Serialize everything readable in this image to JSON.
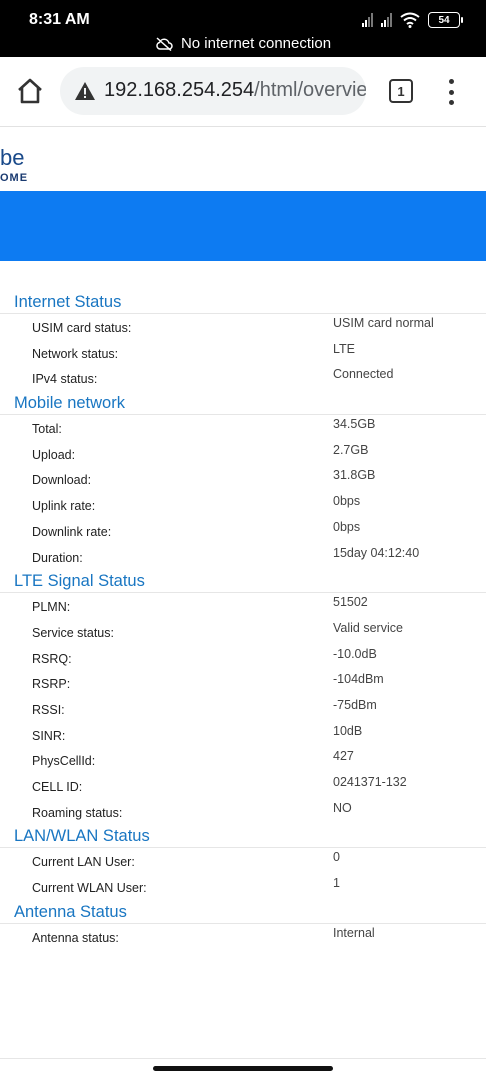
{
  "status_bar": {
    "time": "8:31 AM",
    "battery": "54",
    "network_message": "No internet connection"
  },
  "browser": {
    "url_host": "192.168.254.254",
    "url_path": "/html/overvie",
    "tab_count": "1"
  },
  "logo": {
    "main": "be",
    "sub": "OME"
  },
  "sections": [
    {
      "title": "Internet Status",
      "rows": [
        {
          "label": "USIM card status:",
          "value": "USIM card normal"
        },
        {
          "label": "Network status:",
          "value": "LTE"
        },
        {
          "label": "IPv4 status:",
          "value": "Connected"
        }
      ]
    },
    {
      "title": "Mobile network",
      "rows": [
        {
          "label": "Total:",
          "value": "34.5GB"
        },
        {
          "label": "Upload:",
          "value": "2.7GB"
        },
        {
          "label": "Download:",
          "value": "31.8GB"
        },
        {
          "label": "Uplink rate:",
          "value": "0bps"
        },
        {
          "label": "Downlink rate:",
          "value": "0bps"
        },
        {
          "label": "Duration:",
          "value": "15day 04:12:40"
        }
      ]
    },
    {
      "title": "LTE Signal Status",
      "rows": [
        {
          "label": "PLMN:",
          "value": "51502"
        },
        {
          "label": "Service status:",
          "value": "Valid service"
        },
        {
          "label": "RSRQ:",
          "value": "-10.0dB"
        },
        {
          "label": "RSRP:",
          "value": "-104dBm"
        },
        {
          "label": "RSSI:",
          "value": "-75dBm"
        },
        {
          "label": "SINR:",
          "value": "10dB"
        },
        {
          "label": "PhysCellId:",
          "value": "427"
        },
        {
          "label": "CELL ID:",
          "value": "0241371-132"
        },
        {
          "label": "Roaming status:",
          "value": "NO"
        }
      ]
    },
    {
      "title": "LAN/WLAN Status",
      "rows": [
        {
          "label": "Current LAN User:",
          "value": "0"
        },
        {
          "label": "Current WLAN User:",
          "value": "1"
        }
      ]
    },
    {
      "title": "Antenna Status",
      "rows": [
        {
          "label": "Antenna status:",
          "value": "Internal"
        }
      ]
    }
  ],
  "colors": {
    "accent_blue": "#0d7bf2",
    "section_title": "#1976c2"
  }
}
